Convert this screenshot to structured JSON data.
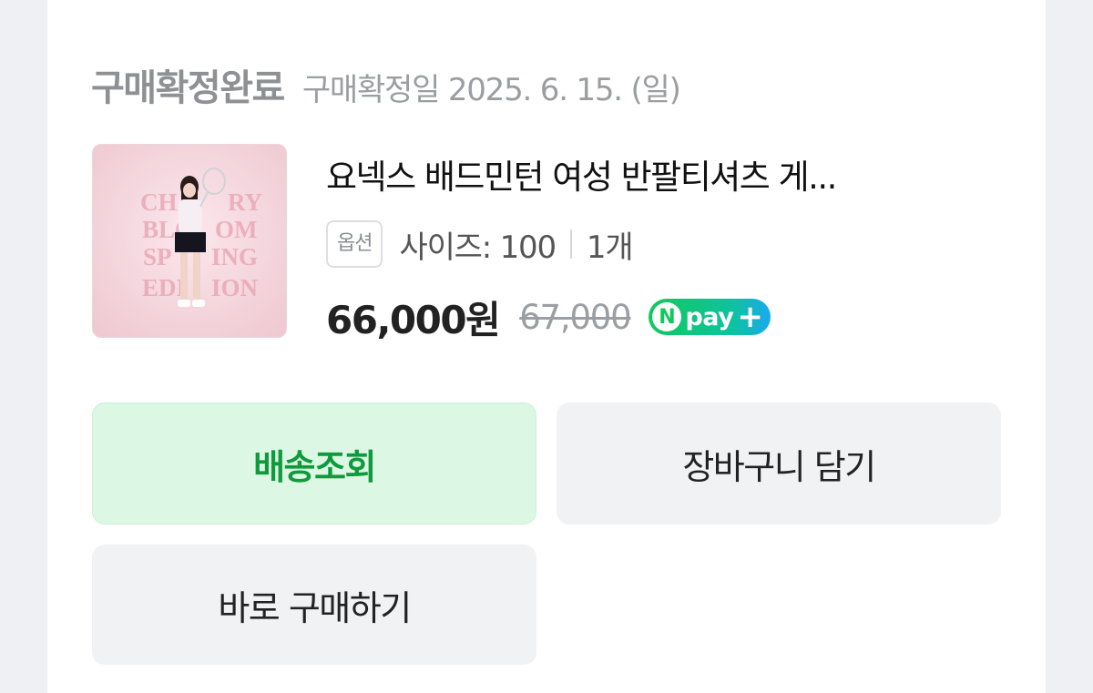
{
  "order": {
    "status": "구매확정완료",
    "confirm_date": "구매확정일 2025. 6. 15. (일)"
  },
  "product": {
    "name": "요넥스 배드민턴 여성 반팔티셔츠 게...",
    "thumbnail_text": "CHERRY BLOSSOM SPRING EDITION",
    "option_tag": "옵션",
    "option_value": "사이즈: 100",
    "quantity": "1개",
    "price": "66,000원",
    "original_price": "67,000",
    "npay_badge": {
      "n": "N",
      "label": "pay",
      "plus": "+"
    }
  },
  "actions": {
    "track_delivery": "배송조회",
    "add_to_cart": "장바구니 담기",
    "buy_now": "바로 구매하기"
  },
  "colors": {
    "accent_green": "#0f9a3c",
    "track_button_bg": "#dcf8e4",
    "neutral_button_bg": "#f0f2f4"
  }
}
